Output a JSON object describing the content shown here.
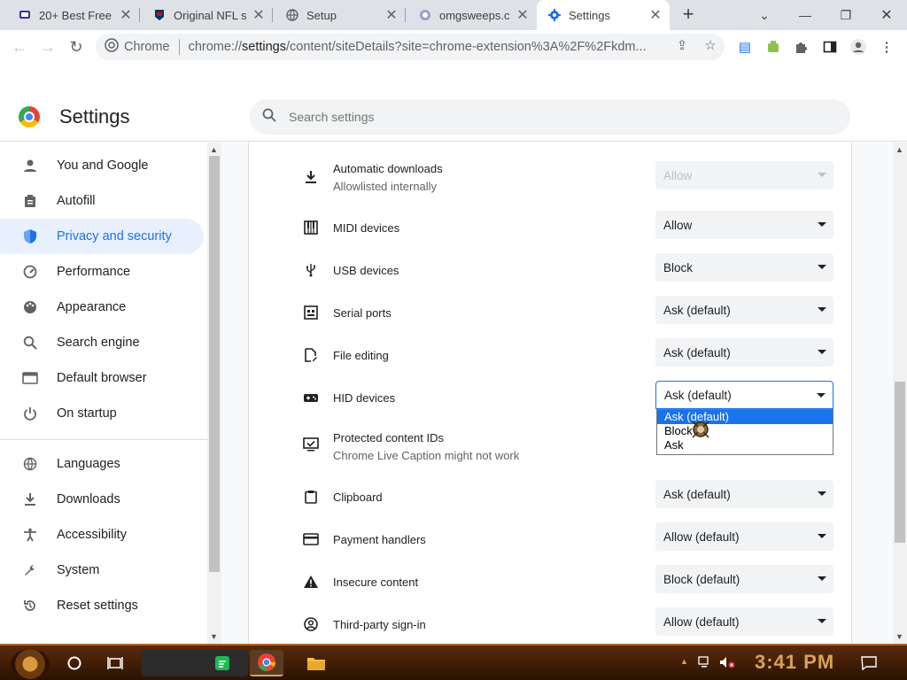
{
  "tabs": [
    {
      "title": "20+ Best Free",
      "icon": "tv-icon"
    },
    {
      "title": "Original NFL s",
      "icon": "nfl-icon"
    },
    {
      "title": "Setup",
      "icon": "globe-icon"
    },
    {
      "title": "omgsweeps.co",
      "icon": "omgsweeps-icon"
    },
    {
      "title": "Settings",
      "icon": "settings-gear-icon"
    }
  ],
  "omnibox": {
    "chip": "Chrome",
    "url_prefix": "chrome://",
    "url_main": "settings",
    "url_rest": "/content/siteDetails?site=chrome-extension%3A%2F%2Fkdm..."
  },
  "header": {
    "title": "Settings",
    "search_placeholder": "Search settings"
  },
  "sidebar": {
    "items": [
      {
        "label": "You and Google",
        "icon": "person-icon"
      },
      {
        "label": "Autofill",
        "icon": "clipboard-icon"
      },
      {
        "label": "Privacy and security",
        "icon": "shield-icon",
        "active": true
      },
      {
        "label": "Performance",
        "icon": "speedometer-icon"
      },
      {
        "label": "Appearance",
        "icon": "palette-icon"
      },
      {
        "label": "Search engine",
        "icon": "search-icon"
      },
      {
        "label": "Default browser",
        "icon": "browser-icon"
      },
      {
        "label": "On startup",
        "icon": "power-icon"
      },
      {
        "label": "Languages",
        "icon": "globe-icon"
      },
      {
        "label": "Downloads",
        "icon": "download-icon"
      },
      {
        "label": "Accessibility",
        "icon": "accessibility-icon"
      },
      {
        "label": "System",
        "icon": "wrench-icon"
      },
      {
        "label": "Reset settings",
        "icon": "reset-icon"
      }
    ]
  },
  "permissions": [
    {
      "label": "Automatic downloads",
      "sub": "Allowlisted internally",
      "value": "Allow",
      "disabled": true,
      "icon": "download-icon"
    },
    {
      "label": "MIDI devices",
      "value": "Allow",
      "icon": "piano-icon"
    },
    {
      "label": "USB devices",
      "value": "Block",
      "icon": "usb-icon"
    },
    {
      "label": "Serial ports",
      "value": "Ask (default)",
      "icon": "serial-port-icon"
    },
    {
      "label": "File editing",
      "value": "Ask (default)",
      "icon": "file-edit-icon"
    },
    {
      "label": "HID devices",
      "value": "Ask (default)",
      "focused": true,
      "icon": "gamepad-icon"
    },
    {
      "label": "Protected content IDs",
      "sub": "Chrome Live Caption might not work",
      "value": "",
      "icon": "monitor-check-icon"
    },
    {
      "label": "Clipboard",
      "value": "Ask (default)",
      "icon": "clipboard-icon"
    },
    {
      "label": "Payment handlers",
      "value": "Allow (default)",
      "icon": "credit-card-icon"
    },
    {
      "label": "Insecure content",
      "value": "Block (default)",
      "icon": "warning-icon"
    },
    {
      "label": "Third-party sign-in",
      "value": "Allow (default)",
      "icon": "account-circle-icon"
    }
  ],
  "dropdown": {
    "options": [
      "Ask (default)",
      "Block",
      "Ask"
    ],
    "selected": "Ask (default)"
  },
  "taskbar": {
    "clock": "3:41 PM"
  }
}
